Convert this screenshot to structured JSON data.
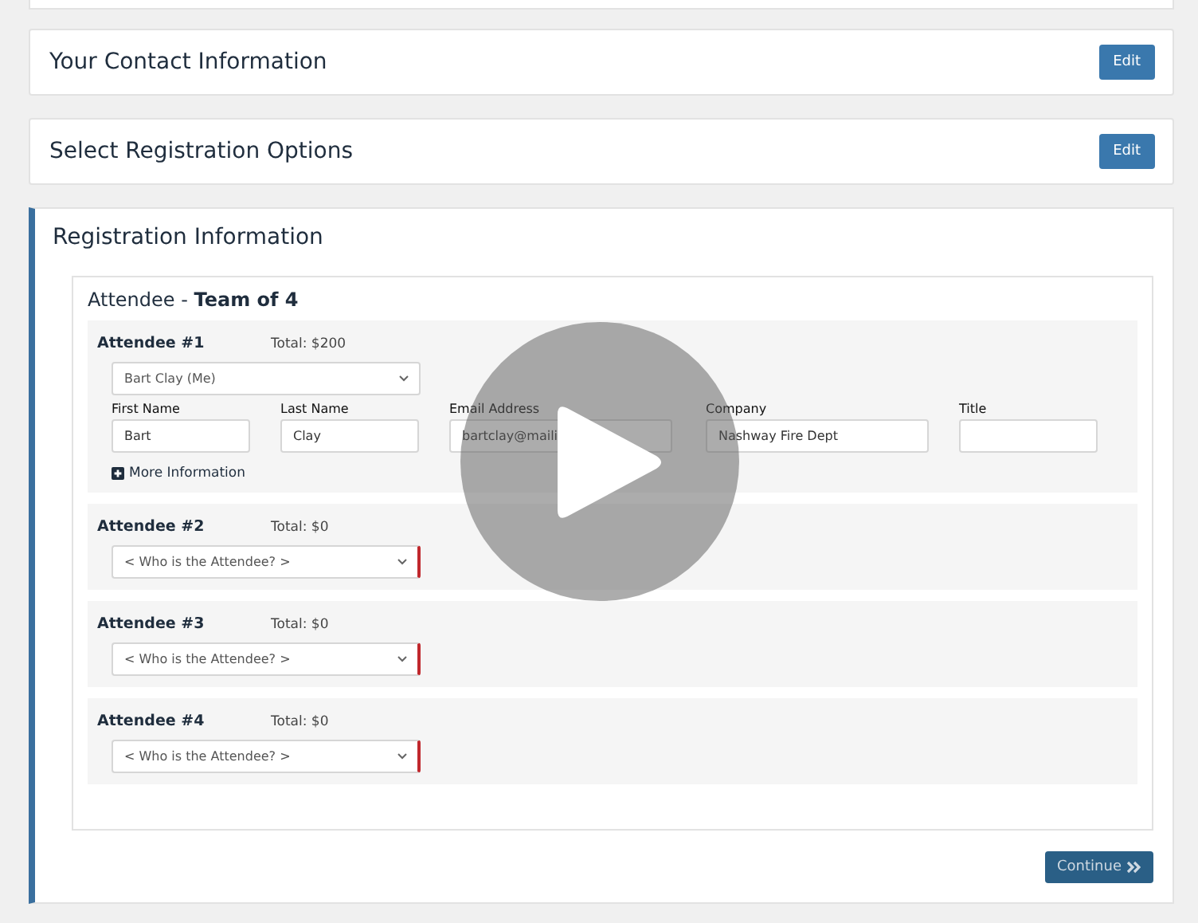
{
  "sections": [
    {
      "title": "Your Contact Information",
      "button": "Edit"
    },
    {
      "title": "Select Registration Options",
      "button": "Edit"
    }
  ],
  "registration": {
    "title": "Registration Information",
    "heading_prefix": "Attendee - ",
    "heading_bold": "Team of 4",
    "attendees": [
      {
        "label": "Attendee #1",
        "total": "Total: $200",
        "select": "Bart Clay (Me)",
        "invalid": false,
        "fields": [
          {
            "label": "First Name",
            "value": "Bart"
          },
          {
            "label": "Last Name",
            "value": "Clay"
          },
          {
            "label": "Email Address",
            "value": "bartclay@maili"
          },
          {
            "label": "Company",
            "value": "Nashway Fire Dept"
          },
          {
            "label": "Title"
          }
        ],
        "more": "More Information"
      },
      {
        "label": "Attendee #2",
        "total": "Total: $0",
        "select": "< Who is the Attendee? >",
        "invalid": true
      },
      {
        "label": "Attendee #3",
        "total": "Total: $0",
        "select": "< Who is the Attendee? >",
        "invalid": true
      },
      {
        "label": "Attendee #4",
        "total": "Total: $0",
        "select": "< Who is the Attendee? >",
        "invalid": true
      }
    ],
    "continue": "Continue"
  }
}
